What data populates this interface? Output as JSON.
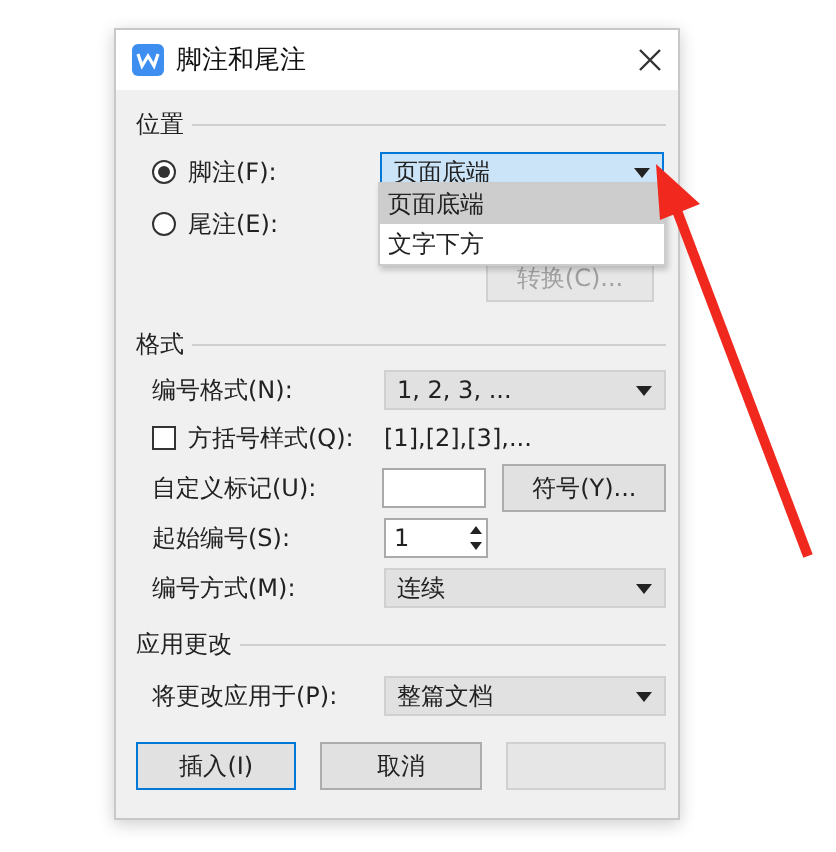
{
  "window": {
    "title": "脚注和尾注"
  },
  "position": {
    "heading": "位置",
    "options": [
      {
        "label": "脚注(F):",
        "selected": true
      },
      {
        "label": "尾注(E):",
        "selected": false
      }
    ],
    "dropdown": {
      "value": "页面底端",
      "open": true,
      "options": [
        {
          "label": "页面底端",
          "selected": true
        },
        {
          "label": "文字下方",
          "selected": false
        }
      ]
    },
    "convert_button": {
      "label": "转换(C)...",
      "disabled": true
    }
  },
  "format": {
    "heading": "格式",
    "number_format": {
      "label": "编号格式(N):",
      "value": "1, 2, 3, ..."
    },
    "brackets": {
      "label": "方括号样式(Q):",
      "checked": false,
      "example": "[1],[2],[3],..."
    },
    "custom_mark": {
      "label": "自定义标记(U):",
      "button": "符号(Y)..."
    },
    "start": {
      "label": "起始编号(S):",
      "value": "1"
    },
    "numbering": {
      "label": "编号方式(M):",
      "value": "连续"
    }
  },
  "apply": {
    "heading": "应用更改",
    "label": "将更改应用于(P):",
    "value": "整篇文档"
  },
  "buttons": [
    {
      "label": "插入(I)",
      "disabled": false,
      "default": true
    },
    {
      "label": "取消",
      "disabled": false,
      "default": false
    },
    {
      "disabled": true,
      "default": false
    }
  ]
}
